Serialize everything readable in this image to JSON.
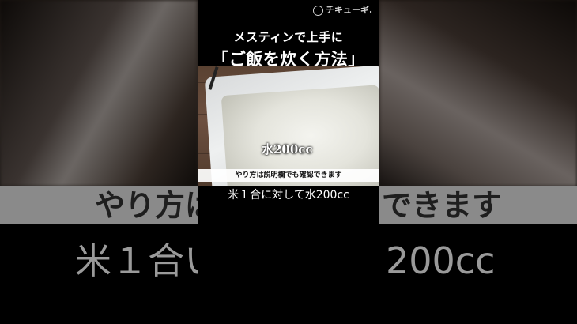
{
  "logo": {
    "text": "チキューギ."
  },
  "title": {
    "line1": "メスティンで上手に",
    "line2": "「ご飯を炊く方法」"
  },
  "photo": {
    "overlay_label": "水200cc"
  },
  "note_bar": {
    "text": "やり方は説明欄でも確認できます"
  },
  "caption": {
    "text": "米１合に対して水200cc"
  },
  "background": {
    "big_caption_left": "やり方は",
    "big_caption_right": "できます",
    "big_sub_left": "米１合い",
    "big_sub_right": "200cc"
  }
}
